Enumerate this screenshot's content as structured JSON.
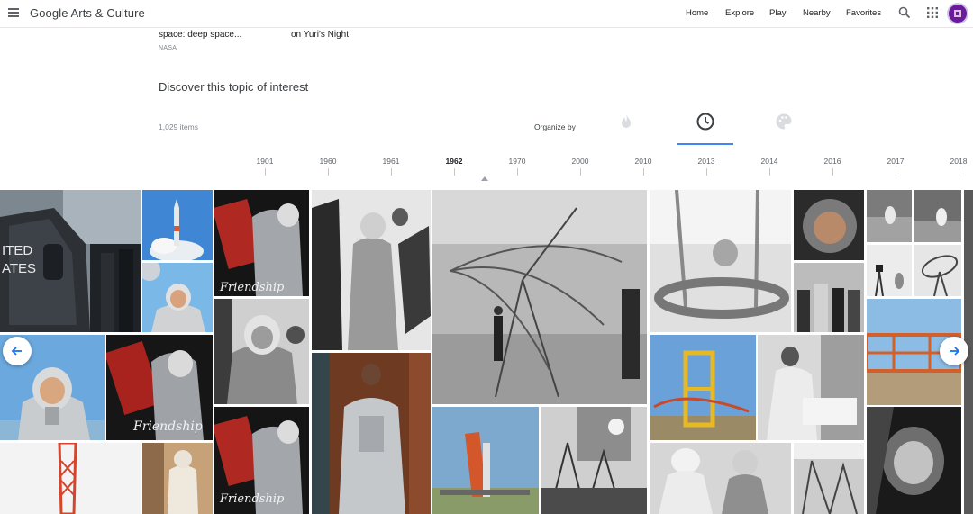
{
  "header": {
    "brand": "Google Arts & Culture",
    "nav": [
      "Home",
      "Explore",
      "Play",
      "Nearby",
      "Favorites"
    ]
  },
  "carousel": {
    "card1_title": "space: deep space...",
    "card1_sub": "NASA",
    "card2_title": "on Yuri's Night"
  },
  "topic": {
    "title": "Discover this topic of interest",
    "count": "1,029 items",
    "organize_label": "Organize by"
  },
  "timeline": {
    "years": [
      "1901",
      "1960",
      "1961",
      "1962",
      "1970",
      "2000",
      "2010",
      "2013",
      "2014",
      "2016",
      "2017",
      "2018"
    ],
    "active": "1962"
  },
  "icons": {
    "menu": "menu-icon",
    "search": "search-icon",
    "apps": "apps-grid-icon",
    "popularity": "flame-icon",
    "time": "clock-icon",
    "color": "palette-icon",
    "prev": "arrow-left-icon",
    "next": "arrow-right-icon"
  },
  "colors": {
    "accent": "#4285f4",
    "avatar": "#6a1b9a"
  },
  "tile_labels": {
    "capsule_text": "ITED\nATES",
    "friendship": "Friendship"
  }
}
